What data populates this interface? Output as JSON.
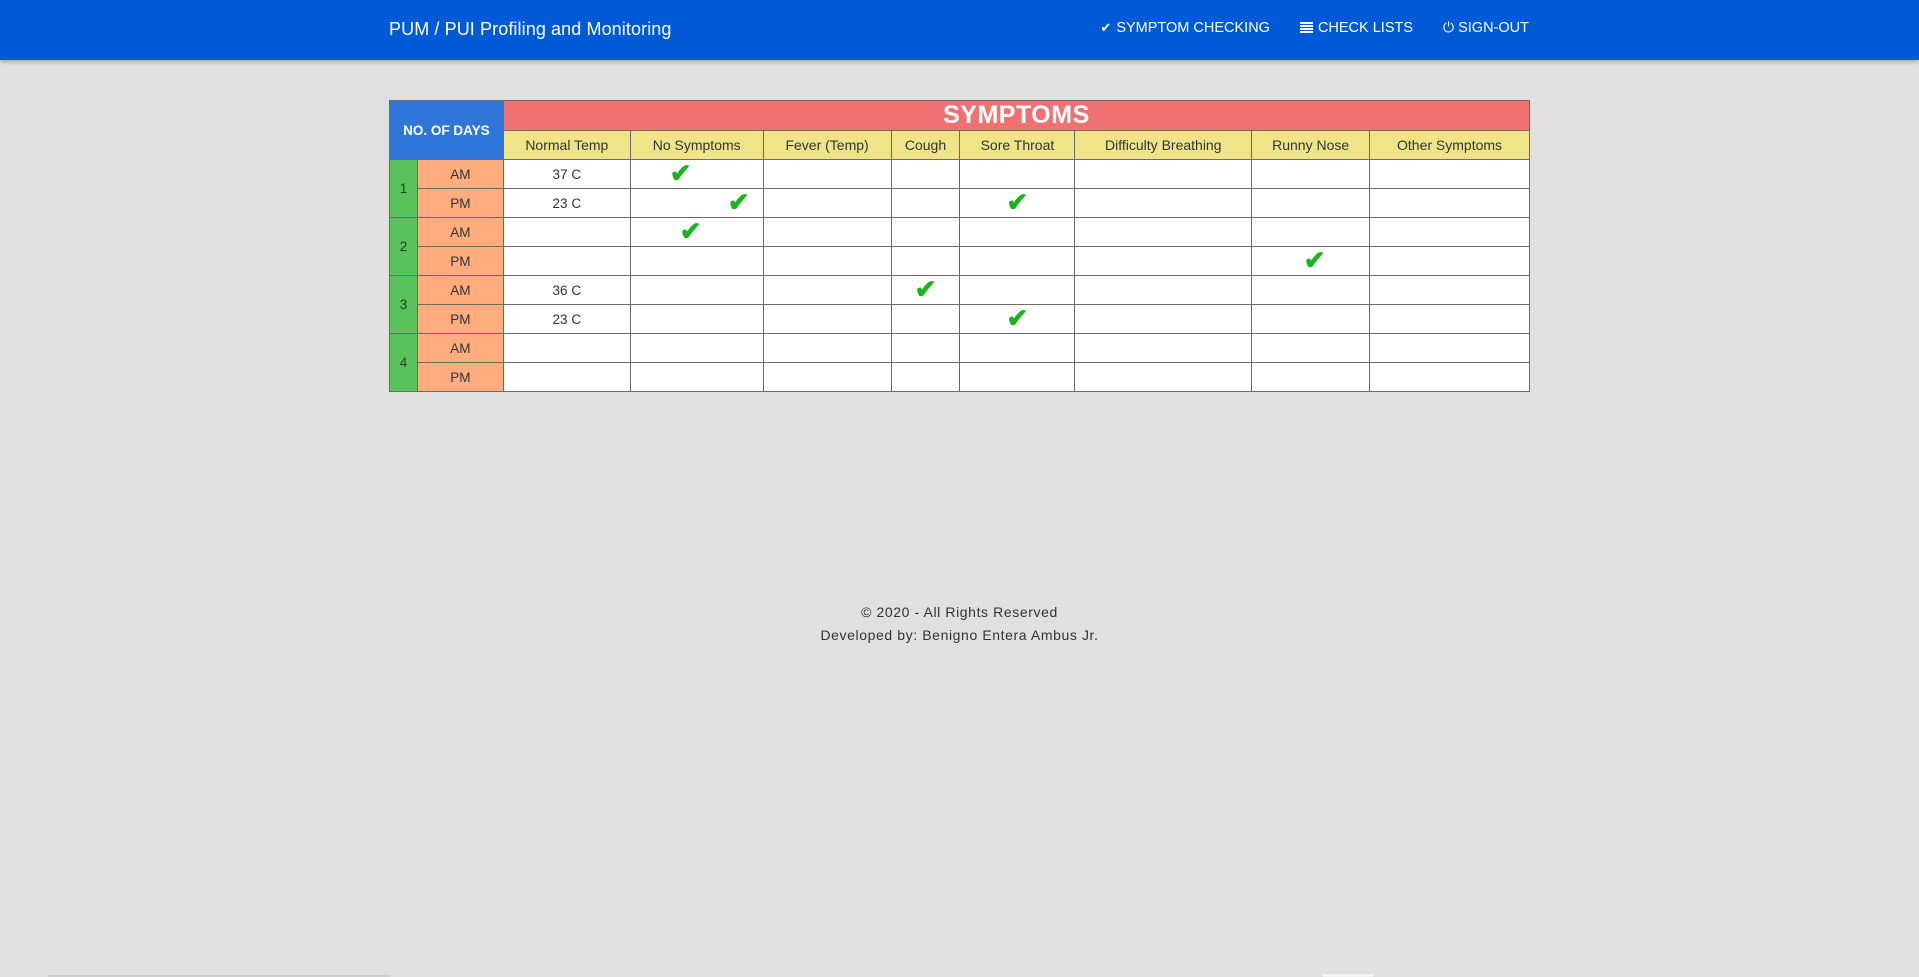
{
  "navbar": {
    "brand": "PUM / PUI Profiling and Monitoring",
    "links": [
      {
        "label": "SYMPTOM CHECKING",
        "icon": "check-icon"
      },
      {
        "label": "CHECK LISTS",
        "icon": "list-icon"
      },
      {
        "label": "SIGN-OUT",
        "icon": "power-icon"
      }
    ]
  },
  "table": {
    "days_header": "NO. OF DAYS",
    "title": "SYMPTOMS",
    "columns": [
      "Normal Temp",
      "No Symptoms",
      "Fever (Temp)",
      "Cough",
      "Sore Throat",
      "Difficulty Breathing",
      "Runny Nose",
      "Other Symptoms"
    ],
    "rows": [
      {
        "day": "1",
        "period": "AM",
        "temp": "37 C",
        "checks": [
          "No Symptoms"
        ]
      },
      {
        "day": "1",
        "period": "PM",
        "temp": "23 C",
        "checks": [
          "No Symptoms",
          "Sore Throat"
        ]
      },
      {
        "day": "2",
        "period": "AM",
        "temp": "",
        "checks": [
          "No Symptoms"
        ]
      },
      {
        "day": "2",
        "period": "PM",
        "temp": "",
        "checks": [
          "Runny Nose"
        ]
      },
      {
        "day": "3",
        "period": "AM",
        "temp": "36 C",
        "checks": [
          "Cough"
        ]
      },
      {
        "day": "3",
        "period": "PM",
        "temp": "23 C",
        "checks": [
          "Sore Throat"
        ]
      },
      {
        "day": "4",
        "period": "AM",
        "temp": "",
        "checks": []
      },
      {
        "day": "4",
        "period": "PM",
        "temp": "",
        "checks": []
      }
    ]
  },
  "footer": {
    "copyright": "© 2020 - All Rights Reserved",
    "developer": "Developed by: Benigno Entera Ambus Jr."
  },
  "colors": {
    "navbar": "#005ad8",
    "days_header": "#2f76d8",
    "symptoms_header": "#f07171",
    "column_header": "#efe487",
    "day_cell": "#58c15a",
    "period_cell": "#ffac7f",
    "check": "#1bb41b"
  }
}
